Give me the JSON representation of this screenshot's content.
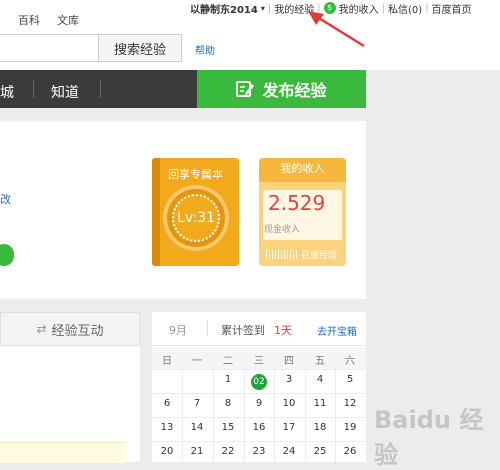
{
  "topnav": {
    "items": [
      "百科",
      "文库"
    ]
  },
  "user": {
    "name": "以静制东2014",
    "chevron_icon": "chevron-down-icon"
  },
  "userlinks": {
    "my_exp": "我的经验",
    "my_income": "我的收入",
    "messages": "私信(0)",
    "home": "百度首页"
  },
  "search": {
    "value": "",
    "button": "搜索经验",
    "help": "帮助"
  },
  "menu": {
    "items": [
      "城",
      "知道"
    ],
    "publish": "发布经验",
    "publish_icon": "edit-icon"
  },
  "profile": {
    "edit_link": "改"
  },
  "book": {
    "title": "回享专属本",
    "level": "Lv:31"
  },
  "income": {
    "title": "我的收入",
    "value": "2.529",
    "label": "现金收入",
    "brand": "百度经验"
  },
  "tab": {
    "label": "经验互动",
    "icon": "swap-icon"
  },
  "calendar": {
    "month": "9月",
    "signin_label": "累计签到",
    "signin_days": "1天",
    "treasure_link": "去开宝箱",
    "weekdays": [
      "日",
      "一",
      "二",
      "三",
      "四",
      "五",
      "六"
    ],
    "week1": [
      "",
      "",
      "1",
      "02",
      "3",
      "4",
      "5"
    ],
    "week2": [
      "6",
      "7",
      "8",
      "9",
      "10",
      "11",
      "12"
    ],
    "week3": [
      "13",
      "14",
      "15",
      "16",
      "17",
      "18",
      "19"
    ],
    "week4": [
      "20",
      "21",
      "22",
      "23",
      "24",
      "25",
      "26"
    ]
  },
  "watermark": "Baidu 经验",
  "colors": {
    "green": "#3aba3c",
    "dark": "#3b3b3b",
    "orange": "#f2a91c",
    "red": "#e0433c",
    "link": "#1a6bc1"
  }
}
